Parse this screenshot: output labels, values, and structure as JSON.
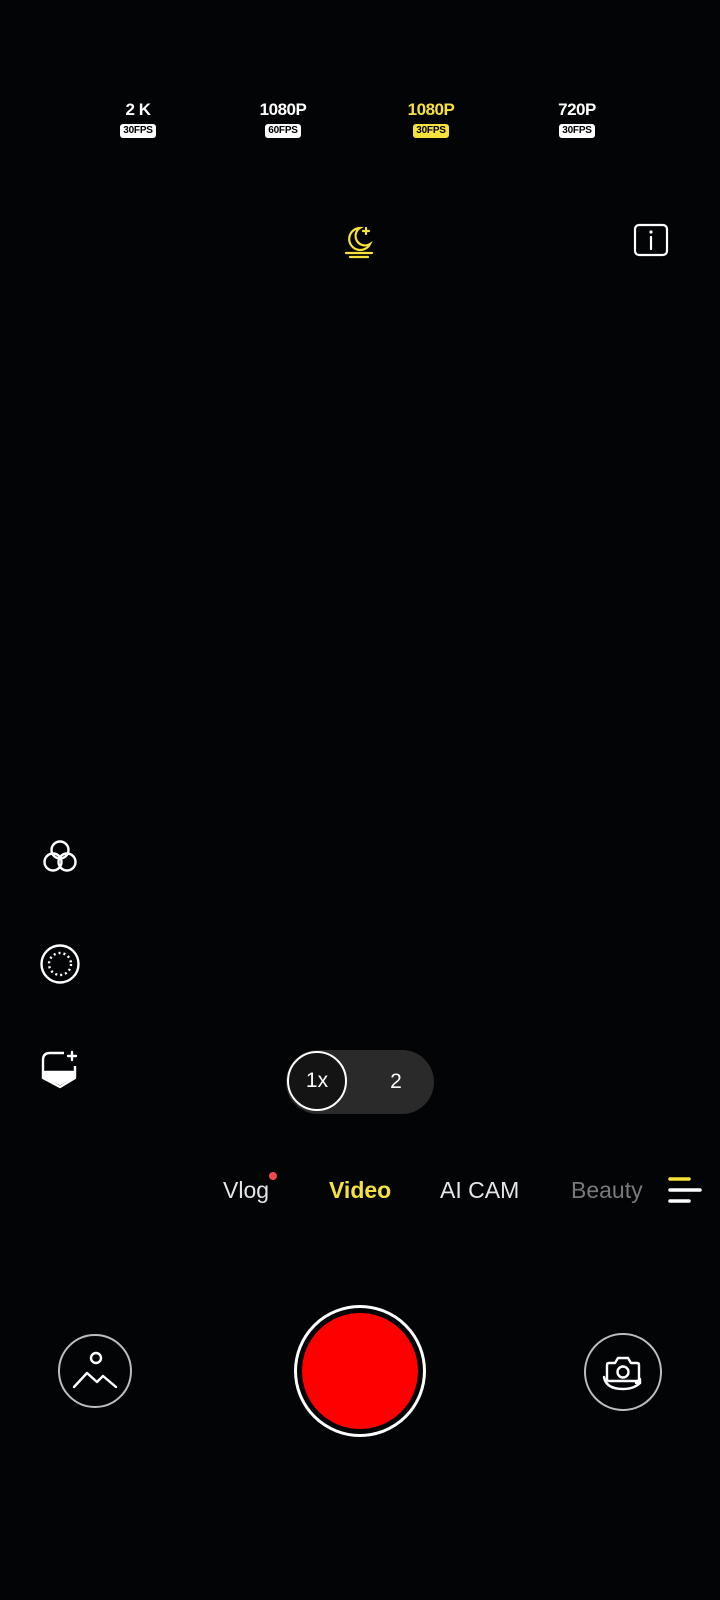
{
  "resolutions": [
    {
      "main": "2 K",
      "fps": "30FPS",
      "active": false
    },
    {
      "main": "1080P",
      "fps": "60FPS",
      "active": false
    },
    {
      "main": "1080P",
      "fps": "30FPS",
      "active": true
    },
    {
      "main": "720P",
      "fps": "30FPS",
      "active": false
    }
  ],
  "icons": {
    "night_mode": "night-mode-moon-icon",
    "info": "info-icon",
    "filters": "filters-icon",
    "portrait_ring": "ring-light-icon",
    "beauty_face": "face-beauty-icon",
    "menu": "menu-lines-icon",
    "gallery": "gallery-icon",
    "flip_camera": "flip-camera-icon"
  },
  "zoom": {
    "active_label": "1x",
    "other_label": "2"
  },
  "modes": [
    {
      "label": "Vlog",
      "has_dot": true
    },
    {
      "label": "Video",
      "active": true
    },
    {
      "label": "AI CAM"
    },
    {
      "label": "Beauty"
    }
  ],
  "colors": {
    "accent": "#f6e23a",
    "record": "#fe0000",
    "notification_dot": "#f24a4a"
  }
}
